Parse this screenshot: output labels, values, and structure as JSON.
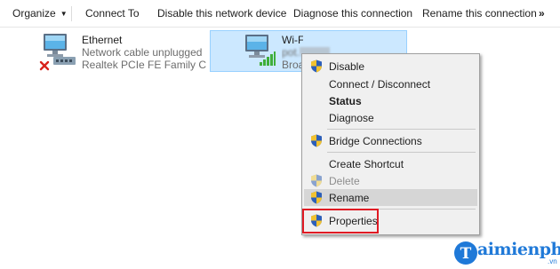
{
  "toolbar": {
    "organize": "Organize",
    "connect_to": "Connect To",
    "disable_device": "Disable this network device",
    "diagnose": "Diagnose this connection",
    "rename": "Rename this connection",
    "more": "»"
  },
  "adapters": [
    {
      "name": "Ethernet",
      "status": "Network cable unplugged",
      "device": "Realtek PCIe FE Family Con...",
      "icon": "ethernet-adapter-icon",
      "badge": "disconnected-x-icon"
    },
    {
      "name": "Wi-Fi",
      "status": "pot...",
      "device": "Broa",
      "icon": "wifi-adapter-icon",
      "badge": "signal-bars-icon",
      "selected": true
    }
  ],
  "context_menu": {
    "items": [
      {
        "label": "Disable",
        "shield": true
      },
      {
        "label": "Connect / Disconnect",
        "shield": false
      },
      {
        "label": "Status",
        "shield": false,
        "bold": true
      },
      {
        "label": "Diagnose",
        "shield": false
      },
      {
        "label": "Bridge Connections",
        "shield": true
      },
      {
        "label": "Create Shortcut",
        "shield": false
      },
      {
        "label": "Delete",
        "shield": true,
        "disabled": true
      },
      {
        "label": "Rename",
        "shield": true,
        "hovered": true
      },
      {
        "label": "Properties",
        "shield": true,
        "outlined": true
      }
    ]
  },
  "watermark": {
    "text": "aimienphi",
    "suffix": ".vn",
    "color": "#1f79d8"
  },
  "colors": {
    "selection_bg": "#cce8ff",
    "selection_border": "#99d1ff",
    "menu_bg": "#f0f0f0",
    "highlight": "#e01b24"
  }
}
